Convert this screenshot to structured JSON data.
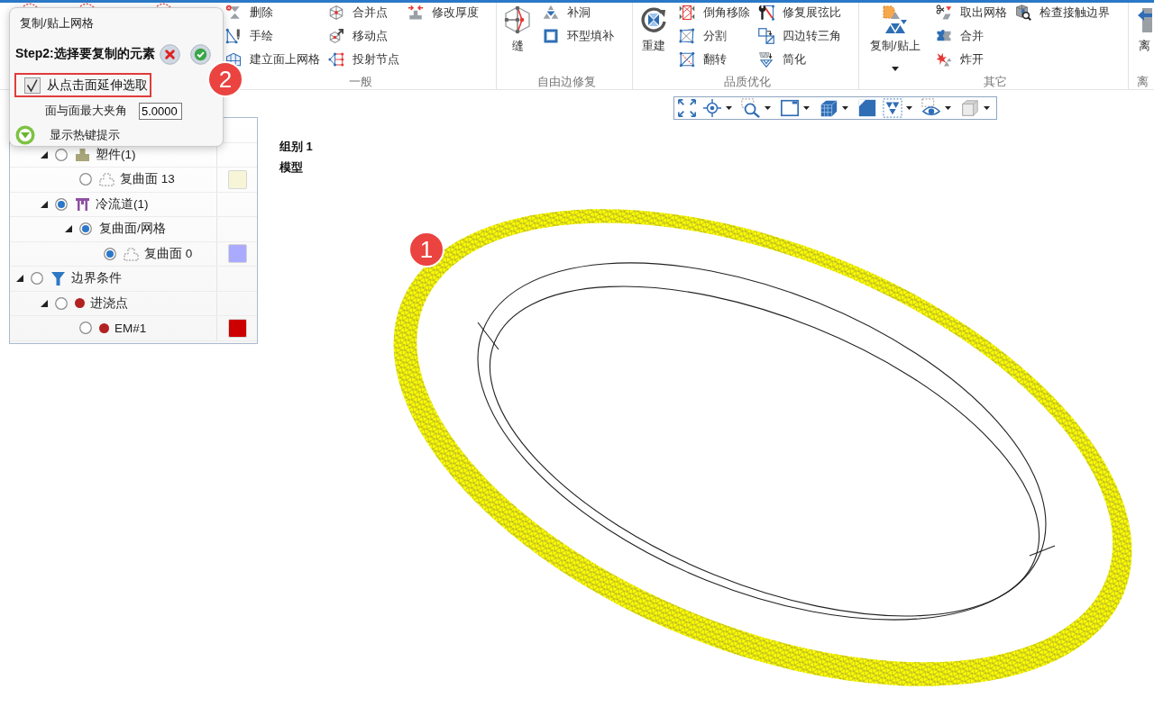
{
  "ribbon": {
    "groups": [
      {
        "label": "一般",
        "columns": [
          [
            "删除",
            "手绘",
            "建立面上网格"
          ],
          [
            "合并点",
            "移动点",
            "投射节点"
          ],
          [
            "修改厚度"
          ]
        ]
      },
      {
        "label": "自由边修复",
        "large": [
          {
            "label": "缝",
            "dropdown": false
          }
        ],
        "columns": [
          [
            "补洞",
            "环型填补"
          ]
        ]
      },
      {
        "label": "品质优化",
        "large": [
          {
            "label": "重建",
            "dropdown": false
          }
        ],
        "columns": [
          [
            "倒角移除",
            "分割",
            "翻转"
          ],
          [
            "修复展弦比",
            "四边转三角",
            "简化"
          ]
        ]
      },
      {
        "label": "其它",
        "large": [
          {
            "label": "复制/贴上",
            "dropdown": true
          }
        ],
        "columns": [
          [
            "取出网格",
            "合并",
            "炸开"
          ],
          [
            "检查接触边界"
          ]
        ]
      },
      {
        "label": "离",
        "large": [
          {
            "label": "离",
            "dropdown": false
          }
        ]
      }
    ]
  },
  "dialog": {
    "title": "复制/贴上网格",
    "step": "Step2:选择要复制的元素",
    "options": [
      {
        "kind": "checkbox",
        "label": "从点击面延伸选取",
        "checked": true,
        "highlighted": true
      },
      {
        "kind": "number",
        "label": "面与面最大夹角",
        "value": "5.0000"
      },
      {
        "kind": "toggle",
        "label": "显示热键提示"
      }
    ],
    "callout": "2"
  },
  "tree": {
    "items": [
      {
        "children": [
          {
            "kind": "part",
            "label": "塑件(1)",
            "selected": false,
            "expanded": true,
            "children": [
              {
                "kind": "surface",
                "label": "复曲面 13",
                "selected": false,
                "color": "#f7f5d7"
              }
            ]
          },
          {
            "kind": "runner",
            "label": "冷流道(1)",
            "selected": true,
            "expanded": true,
            "children": [
              {
                "kind": "mesh_group",
                "label": "复曲面/网格",
                "selected": true,
                "expanded": true,
                "children": [
                  {
                    "kind": "surface",
                    "label": "复曲面 0",
                    "selected": true,
                    "color": "#aaaaff"
                  }
                ]
              }
            ]
          }
        ]
      },
      {
        "kind": "boundary",
        "label": "边界条件",
        "selected": false,
        "expanded": true,
        "children": [
          {
            "kind": "gate",
            "label": "进浇点",
            "selected": false,
            "expanded": true,
            "children": [
              {
                "kind": "point",
                "label": "EM#1",
                "selected": false,
                "color": "#cc0000"
              }
            ]
          }
        ]
      }
    ]
  },
  "view_toolbar": [
    {
      "dropdown": false
    },
    {
      "dropdown": true
    },
    {
      "dropdown": true
    },
    {
      "dropdown": true
    },
    {
      "dropdown": true
    },
    {
      "dropdown": false
    },
    {
      "dropdown": true
    },
    {
      "dropdown": true
    },
    {
      "dropdown": true
    }
  ],
  "viewport": {
    "labels": [
      "组别 1",
      "模型"
    ],
    "callout": "1"
  }
}
